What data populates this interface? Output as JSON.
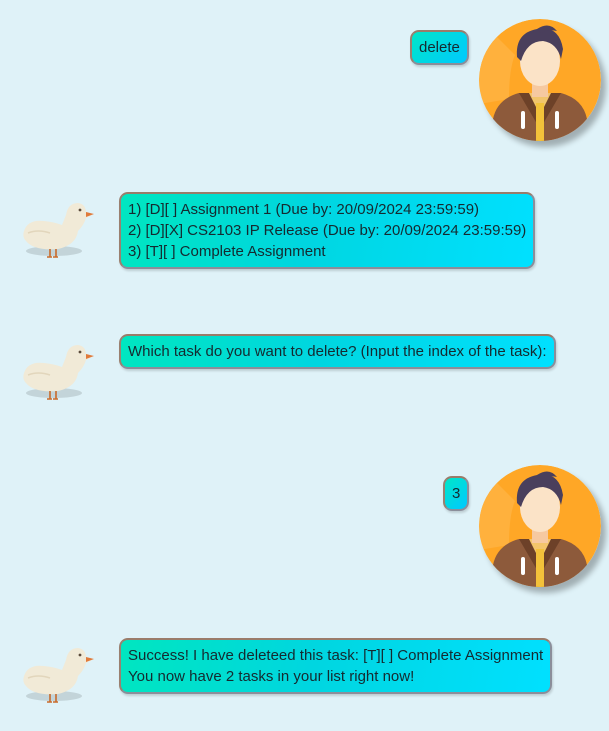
{
  "messages": [
    {
      "sender": "user",
      "lines": [
        "delete"
      ]
    },
    {
      "sender": "bot",
      "lines": [
        "1) [D][ ] Assignment 1 (Due by: 20/09/2024 23:59:59)",
        "2) [D][X] CS2103 IP Release (Due by: 20/09/2024 23:59:59)",
        "3) [T][ ] Complete Assignment"
      ]
    },
    {
      "sender": "bot",
      "lines": [
        "Which task do you want to delete? (Input the index of the task):"
      ]
    },
    {
      "sender": "user",
      "lines": [
        "3"
      ]
    },
    {
      "sender": "bot",
      "lines": [
        "Success! I have deleteed this task: [T][ ] Complete Assignment",
        "You now have 2 tasks in your list right now!"
      ]
    }
  ],
  "icons": {
    "user_avatar": "user-avatar-icon",
    "bot_avatar": "duck-avatar-icon"
  },
  "colors": {
    "background": "#dff2f8",
    "bubble_gradient_start": "#00e6c8",
    "bubble_gradient_end": "#00d8ff",
    "avatar_circle": "#ffa726"
  }
}
